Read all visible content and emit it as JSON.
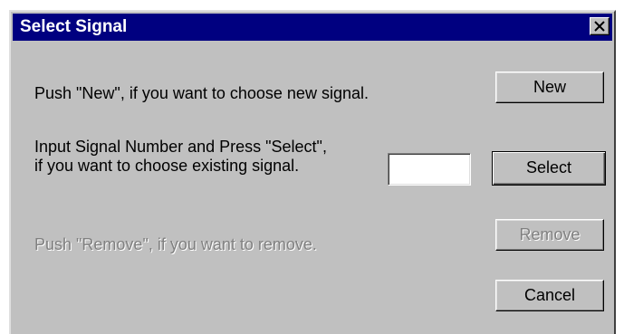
{
  "window": {
    "title": "Select Signal",
    "close_icon": "close-x-icon"
  },
  "new_section": {
    "instruction": "Push \"New\", if you want to choose new signal.",
    "button_label": "New"
  },
  "select_section": {
    "instruction_line1": "Input Signal Number and Press \"Select\",",
    "instruction_line2": " if you want to choose existing signal.",
    "input_value": "",
    "button_label": "Select"
  },
  "remove_section": {
    "instruction": "Push \"Remove\", if you want to remove.",
    "button_label": "Remove"
  },
  "cancel_button_label": "Cancel",
  "colors": {
    "titlebar": "#000080",
    "dialog_face": "#c0c0c0",
    "disabled_text": "#808080"
  }
}
